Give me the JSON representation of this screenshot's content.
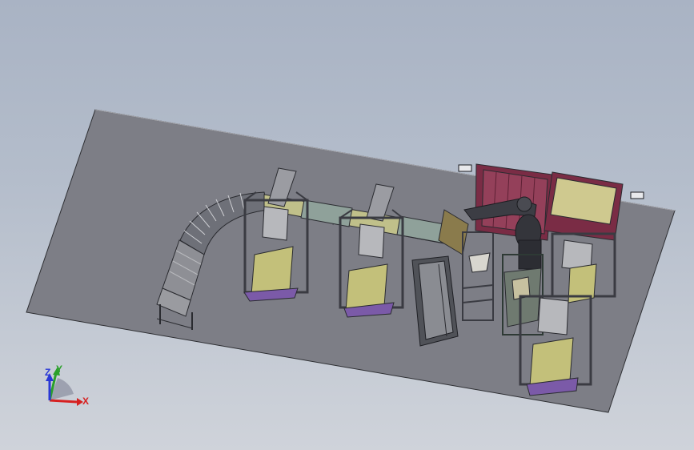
{
  "triad": {
    "x_label": "X",
    "y_label": "Y",
    "z_label": "Z",
    "x_color": "#d62020",
    "y_color": "#2aa02a",
    "z_color": "#2a38d6"
  },
  "colors": {
    "background_top": "#a9b3c4",
    "background_bottom": "#cfd3da",
    "floor_plate": "#7d7e86",
    "frame_steel": "#5c5e66",
    "panel_yellow": "#c3c07a",
    "base_purple": "#7b5aa8",
    "fence_maroon": "#7a2c45"
  }
}
